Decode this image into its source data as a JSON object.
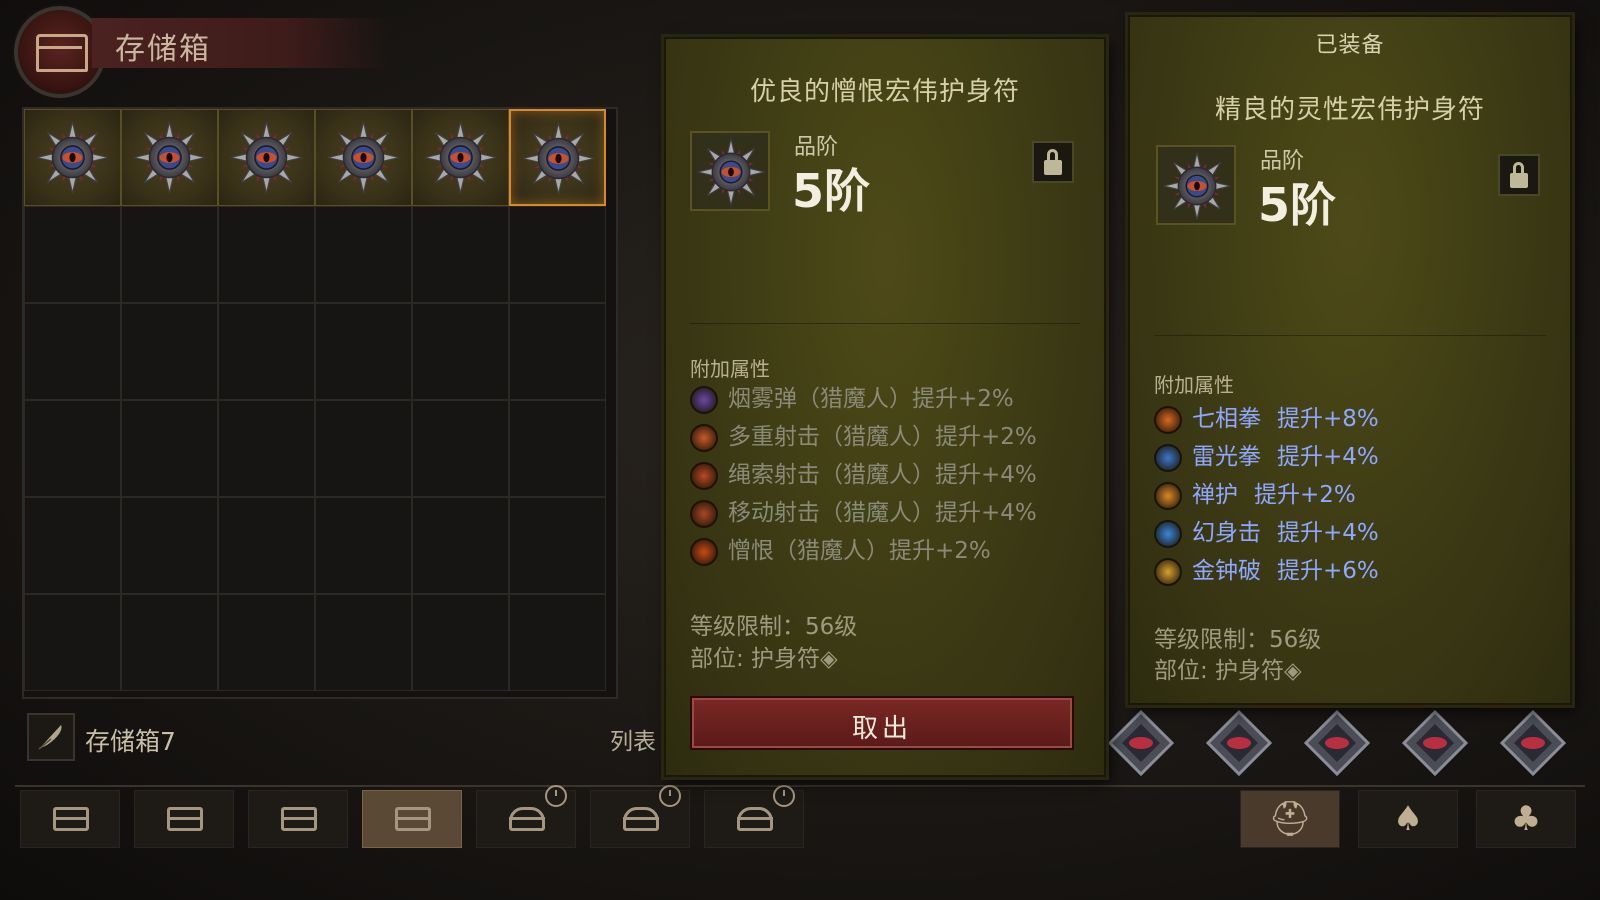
{
  "header": {
    "title": "存储箱"
  },
  "storage": {
    "rows": 6,
    "cols": 6,
    "filled_slots": 6,
    "selected_slot": 6,
    "chest_name": "存储箱7",
    "list_label": "列表"
  },
  "tabs": {
    "active_index": 3,
    "items": [
      "chest",
      "chest",
      "chest",
      "chest",
      "locked-chest",
      "locked-chest",
      "locked-chest"
    ],
    "right": [
      {
        "icon": "helmet-icon",
        "glyph": "⛑"
      },
      {
        "icon": "pouch-icon",
        "glyph": "♠"
      },
      {
        "icon": "bag-icon",
        "glyph": "♣"
      }
    ]
  },
  "selected_item": {
    "name": "优良的憎恨宏伟护身符",
    "tier_label": "品阶",
    "tier_value": "5阶",
    "section": "附加属性",
    "affixes": [
      {
        "text": "烟雾弹（猎魔人）提升+2%",
        "icon": "smoke-bomb-icon",
        "color": "#6a4aa0"
      },
      {
        "text": "多重射击（猎魔人）提升+2%",
        "icon": "multishot-icon",
        "color": "#c85a28"
      },
      {
        "text": "绳索射击（猎魔人）提升+4%",
        "icon": "rope-shot-icon",
        "color": "#b84a22"
      },
      {
        "text": "移动射击（猎魔人）提升+4%",
        "icon": "moving-shot-icon",
        "color": "#a84a22"
      },
      {
        "text": "憎恨（猎魔人）提升+2%",
        "icon": "hatred-icon",
        "color": "#c84a18"
      }
    ],
    "affix_color": "#8a8a78",
    "level_req": "等级限制：56级",
    "slot": "部位: 护身符◈",
    "action": "取出"
  },
  "equipped_item": {
    "header": "已装备",
    "name": "精良的灵性宏伟护身符",
    "tier_label": "品阶",
    "tier_value": "5阶",
    "section": "附加属性",
    "affixes": [
      {
        "name": "七相拳",
        "bonus": "提升+8%",
        "icon": "seven-sided-strike-icon",
        "color": "#d86a20"
      },
      {
        "name": "雷光拳",
        "bonus": "提升+4%",
        "icon": "fists-of-thunder-icon",
        "color": "#3a78c8"
      },
      {
        "name": "禅护",
        "bonus": "提升+2%",
        "icon": "serenity-icon",
        "color": "#d88a28"
      },
      {
        "name": "幻身击",
        "bonus": "提升+4%",
        "icon": "dashing-strike-icon",
        "color": "#3a88d8"
      },
      {
        "name": "金钟破",
        "bonus": "提升+6%",
        "icon": "wave-of-light-icon",
        "color": "#d8a030"
      }
    ],
    "affix_color": "#8fa8ff",
    "level_req": "等级限制：56级",
    "slot": "部位: 护身符◈"
  }
}
